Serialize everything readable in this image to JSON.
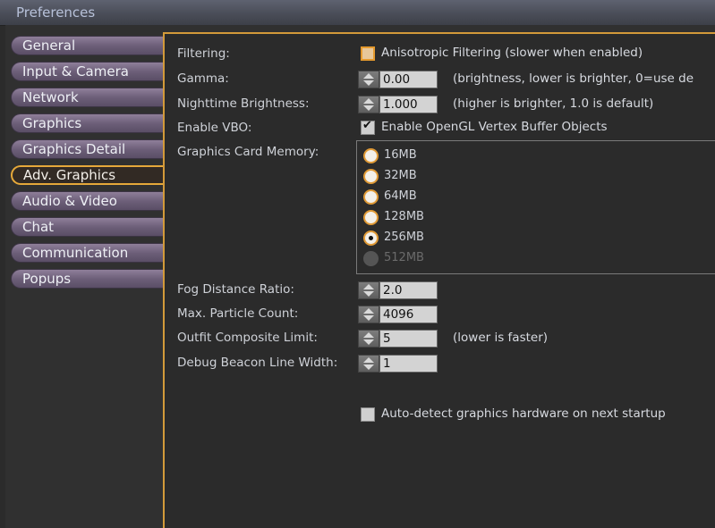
{
  "window": {
    "title": "Preferences"
  },
  "tabs": [
    {
      "label": "General"
    },
    {
      "label": "Input & Camera"
    },
    {
      "label": "Network"
    },
    {
      "label": "Graphics"
    },
    {
      "label": "Graphics Detail"
    },
    {
      "label": "Adv. Graphics",
      "active": true
    },
    {
      "label": "Audio & Video"
    },
    {
      "label": "Chat"
    },
    {
      "label": "Communication"
    },
    {
      "label": "Popups"
    }
  ],
  "settings": {
    "filtering": {
      "label": "Filtering:",
      "checkbox_label": "Anisotropic Filtering (slower when enabled)",
      "checked": false
    },
    "gamma": {
      "label": "Gamma:",
      "value": "0.00",
      "hint": "(brightness, lower is brighter, 0=use de"
    },
    "nighttime_brightness": {
      "label": "Nighttime Brightness:",
      "value": "1.000",
      "hint": "(higher is brighter, 1.0 is default)"
    },
    "enable_vbo": {
      "label": "Enable VBO:",
      "checkbox_label": "Enable OpenGL Vertex Buffer Objects",
      "checked": true
    },
    "graphics_card_memory": {
      "label": "Graphics Card Memory:",
      "options": [
        "16MB",
        "32MB",
        "64MB",
        "128MB",
        "256MB",
        "512MB"
      ],
      "selected": "256MB",
      "disabled": [
        "512MB"
      ]
    },
    "fog_distance_ratio": {
      "label": "Fog Distance Ratio:",
      "value": "2.0"
    },
    "max_particle_count": {
      "label": "Max. Particle Count:",
      "value": "4096"
    },
    "outfit_composite_limit": {
      "label": "Outfit Composite Limit:",
      "value": "5",
      "hint": "(lower is faster)"
    },
    "debug_beacon_line_width": {
      "label": "Debug Beacon Line Width:",
      "value": "1"
    },
    "auto_detect": {
      "checkbox_label": "Auto-detect graphics hardware on next startup",
      "checked": false
    }
  },
  "colors": {
    "accent": "#d39a3a",
    "tab": "#7a6b86",
    "background": "#2b2b2b"
  }
}
